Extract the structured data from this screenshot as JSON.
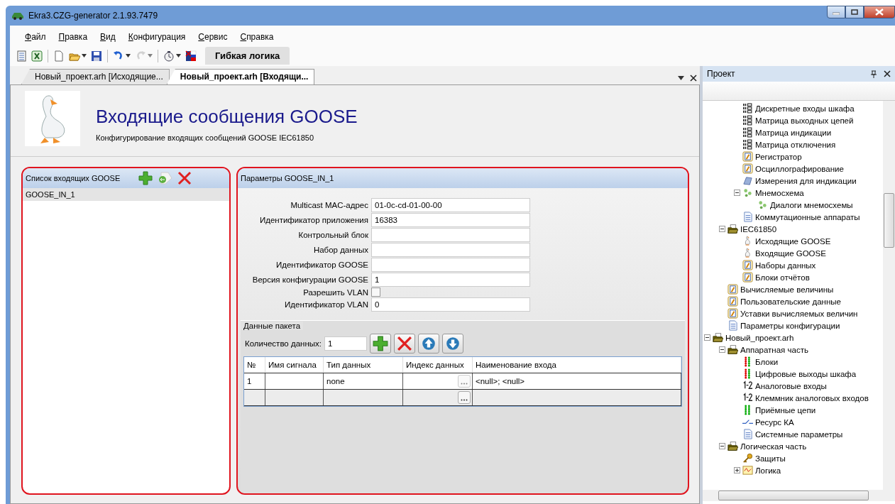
{
  "window": {
    "title": "Ekra3.CZG-generator 2.1.93.7479"
  },
  "menu": [
    "Файл",
    "Правка",
    "Вид",
    "Конфигурация",
    "Сервис",
    "Справка"
  ],
  "toolbar": {
    "buttons": [
      {
        "kind": "list",
        "disabled": false
      },
      {
        "kind": "excel",
        "disabled": false
      },
      {
        "kind": "sep"
      },
      {
        "kind": "new",
        "disabled": false
      },
      {
        "kind": "open",
        "disabled": false,
        "dropdown": true
      },
      {
        "kind": "save",
        "disabled": false
      },
      {
        "kind": "sep"
      },
      {
        "kind": "undo",
        "disabled": false,
        "dropdown": true
      },
      {
        "kind": "redo",
        "disabled": true,
        "dropdown": true
      },
      {
        "kind": "sep"
      },
      {
        "kind": "timer",
        "disabled": false,
        "dropdown": true
      },
      {
        "kind": "flag",
        "disabled": false
      }
    ],
    "label": "Гибкая логика"
  },
  "doc_tabs": [
    {
      "label": "Новый_проект.arh [Исходящие...",
      "selected": false
    },
    {
      "label": "Новый_проект.arh [Входящи...",
      "selected": true
    }
  ],
  "header": {
    "title": "Входящие сообщения GOOSE",
    "subtitle": "Конфигурирование входящих сообщений GOOSE IEC61850"
  },
  "list_panel": {
    "title": "Список входящих GOOSE",
    "items": [
      {
        "label": "GOOSE_IN_1",
        "selected": true
      }
    ]
  },
  "params_panel": {
    "title": "Параметры GOOSE_IN_1",
    "fields": [
      {
        "kind": "text",
        "label": "Multicast MAC-адрес",
        "value": "01-0c-cd-01-00-00"
      },
      {
        "kind": "text",
        "label": "Идентификатор приложения",
        "value": "16383"
      },
      {
        "kind": "text",
        "label": "Контрольный блок"
      },
      {
        "kind": "text",
        "label": "Набор данных"
      },
      {
        "kind": "text",
        "label": "Идентификатор GOOSE"
      },
      {
        "kind": "text",
        "label": "Версия конфигурации GOOSE",
        "value": "1"
      },
      {
        "kind": "checkbox",
        "label": "Разрешить VLAN",
        "checked": false
      },
      {
        "kind": "text",
        "label": "Идентификатор VLAN",
        "value": "0"
      }
    ],
    "packet": {
      "title": "Данные пакета",
      "count_label": "Количество данных:",
      "count": "1",
      "columns": [
        "№",
        "Имя сигнала",
        "Тип данных",
        "Индекс данных",
        "Наименование входа"
      ],
      "rows": [
        {
          "kind": "data",
          "number": "1",
          "data_type": "none",
          "input_name": "<null>; <null>"
        },
        {
          "kind": "new"
        }
      ]
    }
  },
  "project_panel": {
    "title": "Проект",
    "tree": [
      {
        "children": [
          {
            "children": [
              {
                "label": "Дискретные входы шкафа",
                "kind": "matrix"
              },
              {
                "label": "Матрица выходных цепей",
                "kind": "matrix"
              },
              {
                "label": "Матрица индикации",
                "kind": "matrix"
              },
              {
                "label": "Матрица отключения",
                "kind": "matrix"
              },
              {
                "label": "Регистратор",
                "kind": "form"
              },
              {
                "label": "Осциллографирование",
                "kind": "form"
              },
              {
                "label": "Измерения для индикации",
                "kind": "measure"
              },
              {
                "label": "Мнемосхема",
                "kind": "scheme",
                "expanded": true,
                "children": [
                  {
                    "label": "Диалоги мнемосхемы",
                    "kind": "scheme"
                  }
                ]
              },
              {
                "label": "Коммутационные аппараты",
                "kind": "doc"
              }
            ]
          },
          {
            "label": "IEC61850",
            "kind": "folder",
            "expanded": true,
            "children": [
              {
                "label": "Исходящие GOOSE",
                "kind": "goose"
              },
              {
                "label": "Входящие GOOSE",
                "kind": "goose"
              },
              {
                "label": "Наборы данных",
                "kind": "form"
              },
              {
                "label": "Блоки отчётов",
                "kind": "form"
              }
            ]
          },
          {
            "label": "Вычисляемые величины",
            "kind": "form"
          },
          {
            "label": "Пользовательские данные",
            "kind": "form"
          },
          {
            "label": "Уставки вычисляемых величин",
            "kind": "form"
          },
          {
            "label": "Параметры конфигурации",
            "kind": "doc"
          }
        ]
      },
      {
        "label": "Новый_проект.arh",
        "kind": "folder",
        "expanded": true,
        "children": [
          {
            "label": "Аппаратная часть",
            "kind": "folder",
            "expanded": true,
            "children": [
              {
                "label": "Блоки",
                "kind": "leds"
              },
              {
                "label": "Цифровые выходы шкафа",
                "kind": "leds"
              },
              {
                "label": "Аналоговые входы",
                "kind": "analog"
              },
              {
                "label": "Клеммник аналоговых входов",
                "kind": "analog"
              },
              {
                "label": "Приёмные цепи",
                "kind": "greenleds"
              },
              {
                "label": "Ресурс КА",
                "kind": "switch"
              },
              {
                "label": "Системные параметры",
                "kind": "doc"
              }
            ]
          },
          {
            "label": "Логическая часть",
            "kind": "folder",
            "expanded": true,
            "children": [
              {
                "label": "Защиты",
                "kind": "key"
              },
              {
                "label": "Логика",
                "kind": "logic",
                "expanded": false
              }
            ]
          }
        ]
      }
    ]
  }
}
